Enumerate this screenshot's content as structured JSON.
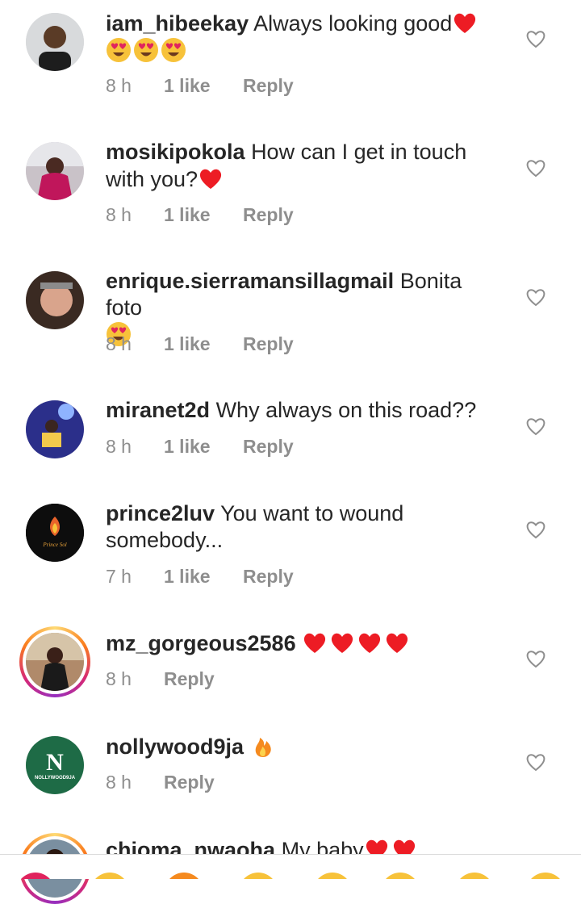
{
  "comments": [
    {
      "username": "iam_hibeekay",
      "text": "Always looking good",
      "emojis": [
        "heart",
        "heart-eyes",
        "heart-eyes",
        "heart-eyes"
      ],
      "time": "8 h",
      "likes": "1 like",
      "reply": "Reply"
    },
    {
      "username": "mosikipokola",
      "text": "How can I get in touch with you?",
      "emojis": [
        "heart"
      ],
      "time": "8 h",
      "likes": "1 like",
      "reply": "Reply"
    },
    {
      "username": "enrique.sierramansillagmail",
      "text": "Bonita foto",
      "emojis": [
        "heart-eyes"
      ],
      "time": "8 h",
      "likes": "1 like",
      "reply": "Reply"
    },
    {
      "username": "miranet2d",
      "text": "Why always on this road??",
      "emojis": [],
      "time": "8 h",
      "likes": "1 like",
      "reply": "Reply"
    },
    {
      "username": "prince2luv",
      "text": "You want to wound somebody...",
      "emojis": [],
      "time": "7 h",
      "likes": "1 like",
      "reply": "Reply",
      "avatar_text": "Prince Sol"
    },
    {
      "username": "mz_gorgeous2586",
      "text": "",
      "emojis": [
        "heart",
        "heart",
        "heart",
        "heart"
      ],
      "time": "8 h",
      "likes": "",
      "reply": "Reply"
    },
    {
      "username": "nollywood9ja",
      "text": "",
      "emojis": [
        "fire"
      ],
      "time": "8 h",
      "likes": "",
      "reply": "Reply",
      "avatar_text": "N",
      "avatar_subtext": "NOLLYWOOD9JA"
    },
    {
      "username": "chioma_nwaoha",
      "text": "My baby",
      "emojis": [
        "heart",
        "heart"
      ],
      "time": "",
      "likes": "",
      "reply": ""
    }
  ],
  "colors": {
    "text": "#262626",
    "meta": "#8e8e8e",
    "heart": "#ed1c24",
    "divider": "#dbdbdb"
  },
  "icons": {
    "like": "heart-outline-icon"
  }
}
